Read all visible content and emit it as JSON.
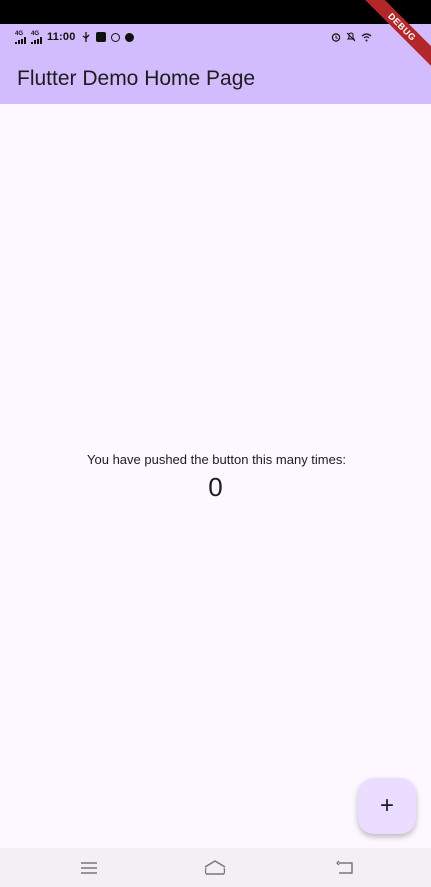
{
  "status_bar": {
    "signal_1_label": "4G",
    "signal_2_label": "4G",
    "time": "11:00"
  },
  "app_bar": {
    "title": "Flutter Demo Home Page",
    "color": "#d3bcfd"
  },
  "debug_banner": {
    "label": "DEBUG",
    "color": "#b3262a"
  },
  "body": {
    "message": "You have pushed the button this many times:",
    "counter": "0",
    "background": "#fdf8ff"
  },
  "fab": {
    "symbol": "+",
    "color": "#eaddff"
  },
  "nav_bar": {
    "items": [
      "menu-icon",
      "home-icon",
      "back-icon"
    ]
  }
}
